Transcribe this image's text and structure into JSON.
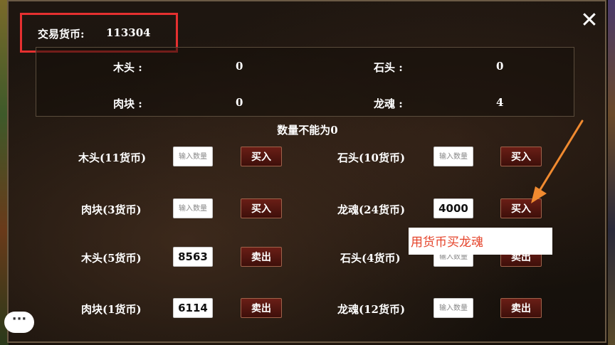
{
  "currency": {
    "label": "交易货币:",
    "value": "113304"
  },
  "inventory": [
    {
      "name": "木头 :",
      "count": "0"
    },
    {
      "name": "石头 :",
      "count": "0"
    },
    {
      "name": "肉块 :",
      "count": "0"
    },
    {
      "name": "龙魂 :",
      "count": "4"
    }
  ],
  "notice": "数量不能为0",
  "trades": [
    {
      "label": "木头(11货币)",
      "input_value": "",
      "placeholder": "输入数量",
      "button": "买入"
    },
    {
      "label": "石头(10货币)",
      "input_value": "",
      "placeholder": "输入数量",
      "button": "买入"
    },
    {
      "label": "肉块(3货币)",
      "input_value": "",
      "placeholder": "输入数量",
      "button": "买入"
    },
    {
      "label": "龙魂(24货币)",
      "input_value": "4000",
      "placeholder": "输入数量",
      "button": "买入"
    },
    {
      "label": "木头(5货币)",
      "input_value": "8563",
      "placeholder": "输入数量",
      "button": "卖出"
    },
    {
      "label": "石头(4货币)",
      "input_value": "",
      "placeholder": "输入数量",
      "button": "卖出"
    },
    {
      "label": "肉块(1货币)",
      "input_value": "6114",
      "placeholder": "输入数量",
      "button": "卖出"
    },
    {
      "label": "龙魂(12货币)",
      "input_value": "",
      "placeholder": "输入数量",
      "button": "卖出"
    }
  ],
  "annotation": "用货币买龙魂",
  "close_symbol": "✕",
  "chat_symbol": "···",
  "colors": {
    "highlight_box": "#e53030",
    "arrow": "#f08a30",
    "button": "#5a1a12",
    "annotation_text": "#e5432a"
  },
  "icons": {
    "close": "close-icon",
    "chat": "chat-bubble-icon"
  }
}
